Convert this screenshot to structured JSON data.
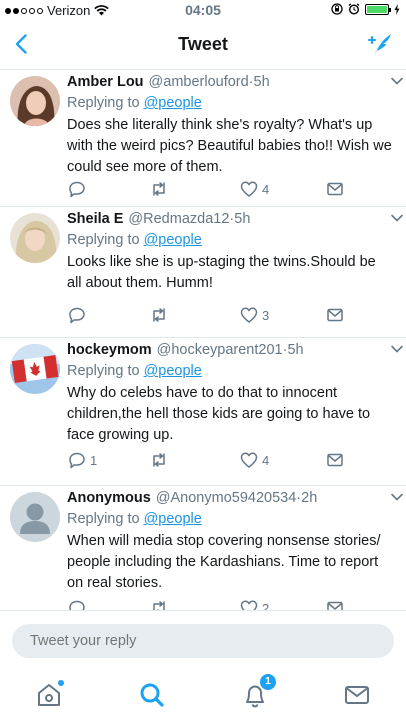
{
  "status_bar": {
    "carrier": "Verizon",
    "time": "04:05",
    "battery_color": "#4cd964"
  },
  "nav": {
    "title": "Tweet",
    "back_icon": "chevron-left-icon",
    "compose_icon": "compose-tweet-icon"
  },
  "tweets": [
    {
      "name": "Amber Lou",
      "handle": "@amberlouford",
      "sep": "·",
      "time": "5h",
      "replying_label": "Replying to",
      "replying_to": "@people",
      "text": "Does she literally think she's royalty? What's up with the weird pics? Beautiful babies tho!! Wish we could see more of them.",
      "reply_count": "",
      "retweet_count": "",
      "like_count": "4"
    },
    {
      "name": "Sheila E",
      "handle": "@Redmazda12",
      "sep": "·",
      "time": "5h",
      "replying_label": "Replying to",
      "replying_to": "@people",
      "text": "Looks like she is up-staging the twins.Should be all about them. Humm!",
      "reply_count": "",
      "retweet_count": "",
      "like_count": "3"
    },
    {
      "name": "hockeymom",
      "handle": "@hockeyparent201",
      "sep": "·",
      "time": "5h",
      "replying_label": "Replying to",
      "replying_to": "@people",
      "text": "Why do celebs have to do that to innocent children,the hell those kids are going to have to face growing up.",
      "reply_count": "1",
      "retweet_count": "",
      "like_count": "4"
    },
    {
      "name": "Anonymous",
      "handle": "@Anonymo59420534",
      "sep": "·",
      "time": "2h",
      "replying_label": "Replying to",
      "replying_to": "@people",
      "text": "When will media stop covering nonsense stories/ people including the Kardashians. Time to report on real stories.",
      "reply_count": "",
      "retweet_count": "",
      "like_count": "2"
    }
  ],
  "reply_bar": {
    "placeholder": "Tweet your reply"
  },
  "tab_bar": {
    "notifications_badge": "1",
    "accent": "#1da1f2"
  }
}
